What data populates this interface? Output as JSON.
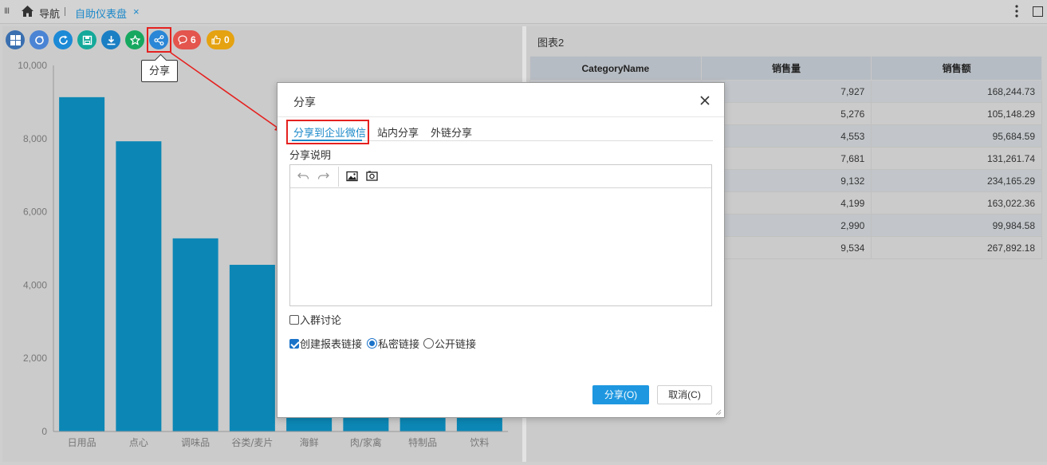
{
  "topbar": {
    "nav_label": "导航",
    "tab_label": "自助仪表盘",
    "tab_close": "×",
    "grip": "III"
  },
  "toolbar": {
    "comments_count": "6",
    "likes_count": "0",
    "share_tooltip": "分享",
    "colors": {
      "layout": "#3a6fb0",
      "refresh_data": "#4b84d4",
      "reload": "#1c8ad6",
      "save": "#14a99a",
      "export": "#1b7fc4",
      "favorite": "#17a860",
      "share": "#2a86d6",
      "comments": "#e3554d",
      "likes": "#e5a211"
    }
  },
  "chart_data": {
    "type": "bar",
    "categories": [
      "日用品",
      "点心",
      "调味品",
      "谷类/麦片",
      "海鲜",
      "肉/家禽",
      "特制品",
      "饮料"
    ],
    "values": [
      9132,
      7927,
      5276,
      4553,
      4199,
      2990,
      7681,
      9534
    ],
    "yticks": [
      "0",
      "2,000",
      "4,000",
      "6,000",
      "8,000",
      "10,000"
    ],
    "ylim": [
      0,
      10000
    ],
    "bar_color": "#0c87b5"
  },
  "right": {
    "title": "图表2",
    "columns": [
      "CategoryName",
      "销售量",
      "销售额"
    ],
    "rows": [
      [
        "",
        "7,927",
        "168,244.73"
      ],
      [
        "",
        "5,276",
        "105,148.29"
      ],
      [
        "",
        "4,553",
        "95,684.59"
      ],
      [
        "",
        "7,681",
        "131,261.74"
      ],
      [
        "",
        "9,132",
        "234,165.29"
      ],
      [
        "",
        "4,199",
        "163,022.36"
      ],
      [
        "",
        "2,990",
        "99,984.58"
      ],
      [
        "",
        "9,534",
        "267,892.18"
      ]
    ]
  },
  "dialog": {
    "title": "分享",
    "tabs": [
      "分享到企业微信",
      "站内分享",
      "外链分享"
    ],
    "desc_label": "分享说明",
    "join_group": "入群讨论",
    "create_link": "创建报表链接",
    "private_link": "私密链接",
    "public_link": "公开链接",
    "share_button": "分享(O)",
    "cancel_button": "取消(C)"
  }
}
